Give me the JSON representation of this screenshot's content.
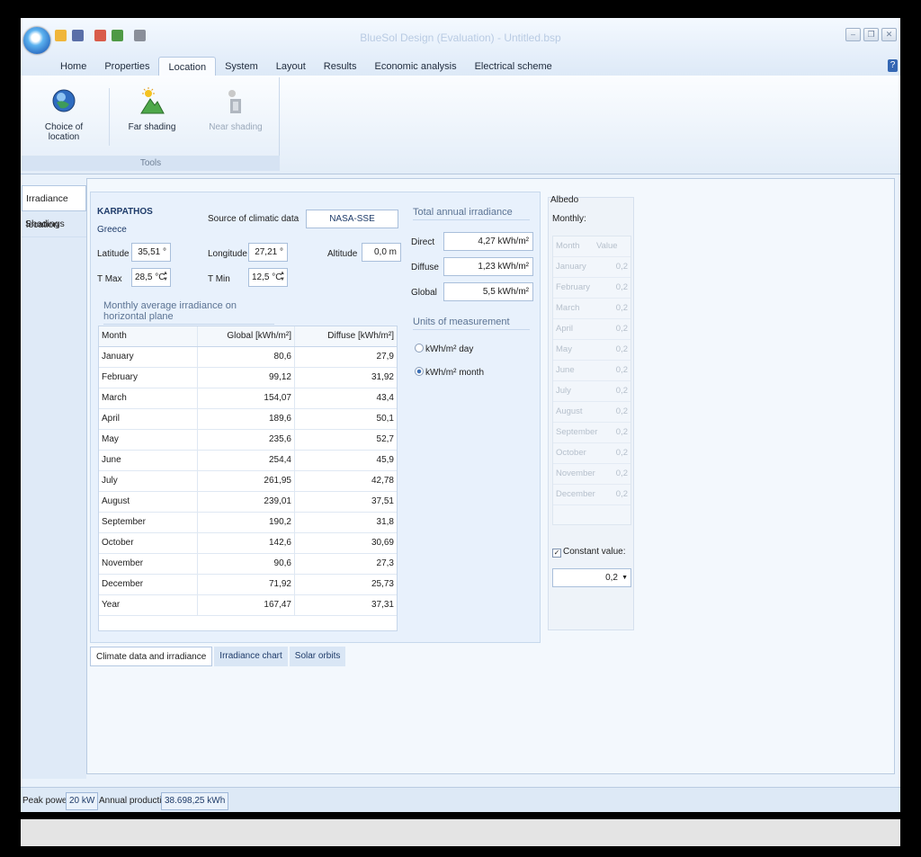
{
  "window": {
    "title": "BlueSol Design (Evaluation) - Untitled.bsp",
    "help": "?"
  },
  "ribbon_tabs": [
    "Home",
    "Properties",
    "Location",
    "System",
    "Layout",
    "Results",
    "Economic analysis",
    "Electrical scheme"
  ],
  "ribbon": {
    "choice_of_location": "Choice of location",
    "far_shading": "Far shading",
    "near_shading": "Near shading",
    "group": "Tools"
  },
  "sidenav": [
    "Irradiance location",
    "Shadings"
  ],
  "location": {
    "name": "KARPATHOS",
    "country": "Greece",
    "source_label": "Source of climatic data",
    "source_value": "NASA-SSE",
    "latitude_label": "Latitude",
    "latitude": "35,51 °",
    "longitude_label": "Longitude",
    "longitude": "27,21 °",
    "altitude_label": "Altitude",
    "altitude": "0,0 m",
    "tmax_label": "T Max",
    "tmax": "28,5 °C",
    "tmin_label": "T Min",
    "tmin": "12,5 °C"
  },
  "monthly": {
    "title": "Monthly average irradiance on horizontal plane",
    "headers": [
      "Month",
      "Global [kWh/m²]",
      "Diffuse [kWh/m²]"
    ],
    "rows": [
      [
        "January",
        "80,6",
        "27,9"
      ],
      [
        "February",
        "99,12",
        "31,92"
      ],
      [
        "March",
        "154,07",
        "43,4"
      ],
      [
        "April",
        "189,6",
        "50,1"
      ],
      [
        "May",
        "235,6",
        "52,7"
      ],
      [
        "June",
        "254,4",
        "45,9"
      ],
      [
        "July",
        "261,95",
        "42,78"
      ],
      [
        "August",
        "239,01",
        "37,51"
      ],
      [
        "September",
        "190,2",
        "31,8"
      ],
      [
        "October",
        "142,6",
        "30,69"
      ],
      [
        "November",
        "90,6",
        "27,3"
      ],
      [
        "December",
        "71,92",
        "25,73"
      ],
      [
        "Year",
        "167,47",
        "37,31"
      ]
    ]
  },
  "annual": {
    "title": "Total annual irradiance",
    "direct_label": "Direct",
    "direct": "4,27 kWh/m²",
    "diffuse_label": "Diffuse",
    "diffuse": "1,23 kWh/m²",
    "global_label": "Global",
    "global": "5,5 kWh/m²"
  },
  "units": {
    "title": "Units of measurement",
    "day": "kWh/m² day",
    "month": "kWh/m² month",
    "selected": "month"
  },
  "subtabs": [
    "Climate data and irradiance",
    "Irradiance chart",
    "Solar orbits"
  ],
  "albedo": {
    "title": "Albedo",
    "monthly_label": "Monthly:",
    "headers": [
      "Month",
      "Value"
    ],
    "rows": [
      [
        "January",
        "0,2"
      ],
      [
        "February",
        "0,2"
      ],
      [
        "March",
        "0,2"
      ],
      [
        "April",
        "0,2"
      ],
      [
        "May",
        "0,2"
      ],
      [
        "June",
        "0,2"
      ],
      [
        "July",
        "0,2"
      ],
      [
        "August",
        "0,2"
      ],
      [
        "September",
        "0,2"
      ],
      [
        "October",
        "0,2"
      ],
      [
        "November",
        "0,2"
      ],
      [
        "December",
        "0,2"
      ]
    ],
    "constant_label": "Constant value:",
    "constant_value": "0,2"
  },
  "status": {
    "peak_label": "Peak power:",
    "peak_value": "20 kW",
    "annual_label": "Annual production:",
    "annual_value": "38.698,25 kWh"
  },
  "colors": {
    "accent": "#3467b3",
    "panel": "#e8f1fc"
  }
}
